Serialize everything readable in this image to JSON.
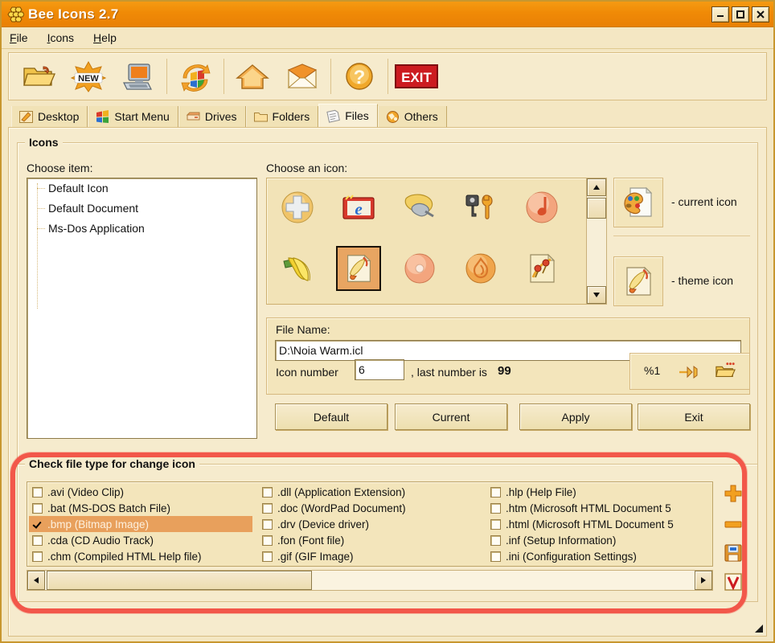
{
  "window": {
    "title": "Bee Icons 2.7",
    "logo_icon": "bee-honeycomb-icon",
    "minimize_label": "_",
    "maximize_label": "□",
    "close_label": "×"
  },
  "menu": {
    "items": [
      {
        "label": "File",
        "accel": "F"
      },
      {
        "label": "Icons",
        "accel": "I"
      },
      {
        "label": "Help",
        "accel": "H"
      }
    ]
  },
  "toolbar": {
    "buttons": [
      {
        "name": "open-file-button",
        "icon": "open-folder-icon",
        "tooltip": "Open"
      },
      {
        "name": "new-button",
        "icon": "new-star-icon",
        "tooltip": "New"
      },
      {
        "name": "computer-button",
        "icon": "computer-icon",
        "tooltip": "Computer"
      },
      {
        "name": "refresh-button",
        "icon": "refresh-windows-icon",
        "tooltip": "Refresh"
      },
      {
        "name": "home-button",
        "icon": "home-icon",
        "tooltip": "Home"
      },
      {
        "name": "mail-button",
        "icon": "envelope-icon",
        "tooltip": "Mail"
      },
      {
        "name": "help-button",
        "icon": "question-icon",
        "tooltip": "Help"
      },
      {
        "name": "exit-button",
        "icon": "exit-icon",
        "label": "EXIT",
        "tooltip": "Exit"
      }
    ]
  },
  "tabs": [
    {
      "label": "Desktop",
      "icon": "desktop-pencil-icon",
      "active": false
    },
    {
      "label": "Start Menu",
      "icon": "windows-flag-icon",
      "active": false
    },
    {
      "label": "Drives",
      "icon": "drive-icon",
      "active": false
    },
    {
      "label": "Folders",
      "icon": "folder-icon",
      "active": false
    },
    {
      "label": "Files",
      "icon": "files-icon",
      "active": true
    },
    {
      "label": "Others",
      "icon": "others-ball-icon",
      "active": false
    }
  ],
  "icons_group": {
    "title": "Icons",
    "choose_item_label": "Choose item:",
    "choose_icon_label": "Choose an icon:",
    "tree_items": [
      "Default Icon",
      "Default Document",
      "Ms-Dos Application"
    ],
    "icon_grid": [
      {
        "name": "plus-circle-icon",
        "selected": false
      },
      {
        "name": "ie-browser-icon",
        "selected": false
      },
      {
        "name": "plug-hand-icon",
        "selected": false
      },
      {
        "name": "key-wrench-icon",
        "selected": false
      },
      {
        "name": "music-note-icon",
        "selected": false
      },
      {
        "name": "bananas-icon",
        "selected": false
      },
      {
        "name": "paint-document-icon",
        "selected": true
      },
      {
        "name": "disc-icon",
        "selected": false
      },
      {
        "name": "flame-circle-icon",
        "selected": false
      },
      {
        "name": "pins-document-icon",
        "selected": false
      }
    ],
    "preview": {
      "current_icon_label": "- current icon",
      "current_icon_name": "palette-document-icon",
      "theme_icon_label": "- theme icon",
      "theme_icon_name": "brush-document-icon"
    },
    "file_name_label": "File Name:",
    "file_name_value": "D:\\Noia Warm.icl",
    "icon_number_label": "Icon number",
    "icon_number_value": "6",
    "last_number_label": ", last number is",
    "last_number_value": "99",
    "tools": [
      {
        "name": "percent-one-label",
        "label": "%1"
      },
      {
        "name": "extract-icon",
        "label": ""
      },
      {
        "name": "browse-folder-icon",
        "label": ""
      }
    ],
    "buttons": [
      {
        "name": "default-button",
        "label": "Default"
      },
      {
        "name": "current-button",
        "label": "Current"
      },
      {
        "name": "apply-button",
        "label": "Apply"
      },
      {
        "name": "exit-button",
        "label": "Exit"
      }
    ]
  },
  "filetype_group": {
    "title": "Check file type for change icon",
    "columns": [
      [
        {
          "label": ".avi (Video Clip)",
          "checked": false,
          "selected": false
        },
        {
          "label": ".bat (MS-DOS Batch File)",
          "checked": false,
          "selected": false
        },
        {
          "label": ".bmp (Bitmap Image)",
          "checked": true,
          "selected": true
        },
        {
          "label": ".cda (CD Audio Track)",
          "checked": false,
          "selected": false
        },
        {
          "label": ".chm (Compiled HTML Help file)",
          "checked": false,
          "selected": false
        }
      ],
      [
        {
          "label": ".dll (Application Extension)",
          "checked": false,
          "selected": false
        },
        {
          "label": ".doc (WordPad Document)",
          "checked": false,
          "selected": false
        },
        {
          "label": ".drv (Device driver)",
          "checked": false,
          "selected": false
        },
        {
          "label": ".fon (Font file)",
          "checked": false,
          "selected": false
        },
        {
          "label": ".gif (GIF Image)",
          "checked": false,
          "selected": false
        }
      ],
      [
        {
          "label": ".hlp (Help File)",
          "checked": false,
          "selected": false
        },
        {
          "label": ".htm (Microsoft HTML Document 5",
          "checked": false,
          "selected": false
        },
        {
          "label": ".html (Microsoft HTML Document 5",
          "checked": false,
          "selected": false
        },
        {
          "label": ".inf (Setup Information)",
          "checked": false,
          "selected": false
        },
        {
          "label": ".ini (Configuration Settings)",
          "checked": false,
          "selected": false
        }
      ]
    ],
    "side_buttons": [
      {
        "name": "add-filetype-button",
        "icon": "plus-icon"
      },
      {
        "name": "remove-filetype-button",
        "icon": "minus-icon"
      },
      {
        "name": "save-filetype-button",
        "icon": "floppy-icon"
      },
      {
        "name": "verify-filetype-button",
        "icon": "v-check-icon"
      }
    ],
    "scroll_left_label": "◄",
    "scroll_right_label": "►"
  },
  "colors": {
    "titlebar": "#f08a06",
    "panel": "#f6ebcd",
    "selection": "#e8a05c",
    "annotation": "#f2574a"
  }
}
